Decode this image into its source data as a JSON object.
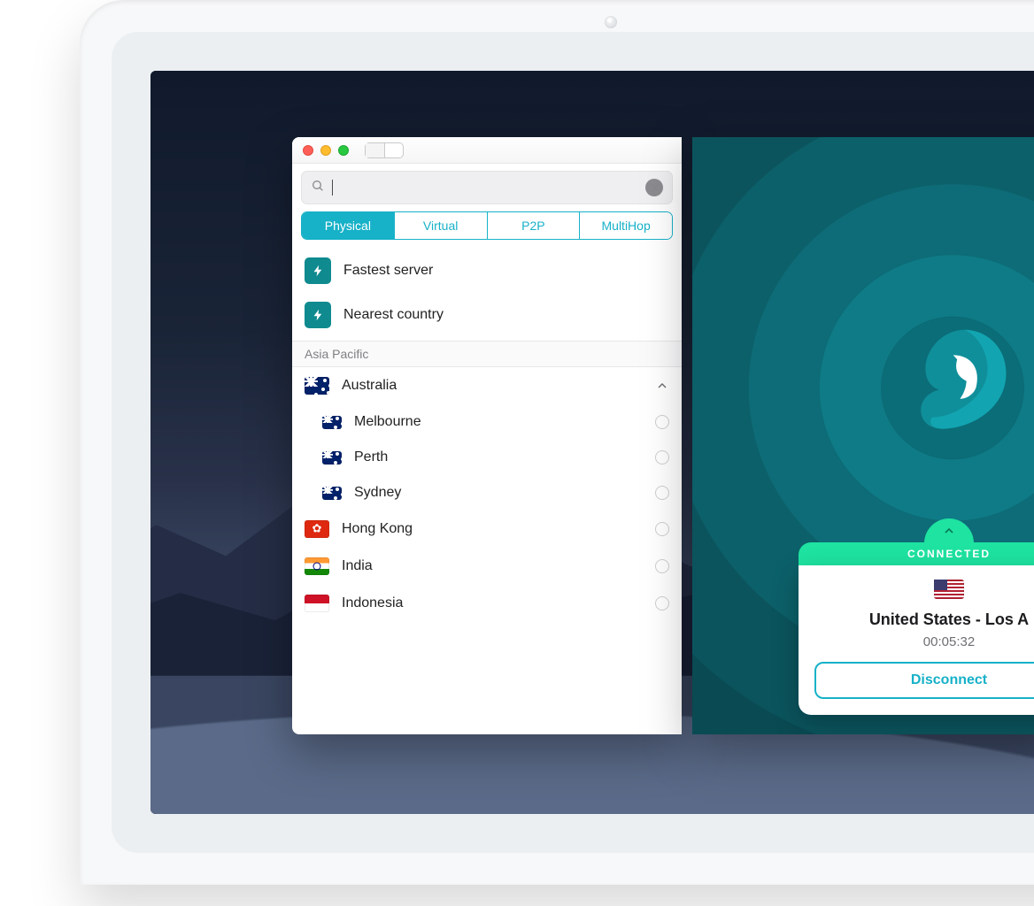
{
  "tabs": [
    "Physical",
    "Virtual",
    "P2P",
    "MultiHop"
  ],
  "active_tab": "Physical",
  "quick": {
    "fastest": "Fastest server",
    "nearest": "Nearest country"
  },
  "section": "Asia Pacific",
  "countries": [
    {
      "name": "Australia",
      "flag": "au",
      "expanded": true,
      "cities": [
        "Melbourne",
        "Perth",
        "Sydney"
      ]
    },
    {
      "name": "Hong Kong",
      "flag": "hk"
    },
    {
      "name": "India",
      "flag": "in"
    },
    {
      "name": "Indonesia",
      "flag": "id"
    }
  ],
  "status": {
    "label": "CONNECTED",
    "flag": "us",
    "location": "United States - Los A",
    "timer": "00:05:32",
    "disconnect": "Disconnect"
  },
  "colors": {
    "accent": "#17b1c8",
    "teal_dark": "#0f8a8f",
    "green": "#1ee3a1"
  }
}
